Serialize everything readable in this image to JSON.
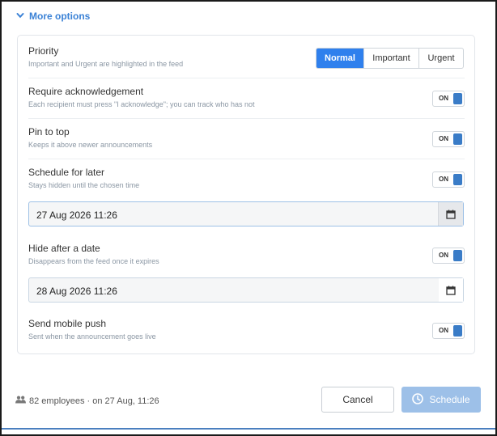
{
  "more_options": {
    "label": "More options",
    "icon": "chevron-down-icon",
    "color": "#3b82d6"
  },
  "priority": {
    "title": "Priority",
    "description": "Important and Urgent are highlighted in the feed",
    "options": [
      "Normal",
      "Important",
      "Urgent"
    ],
    "selected": "Normal"
  },
  "acknowledge": {
    "title": "Require acknowledgement",
    "description": "Each recipient must press \"I acknowledge\"; you can track who has not",
    "toggle": "ON"
  },
  "pin": {
    "title": "Pin to top",
    "description": "Keeps it above newer announcements",
    "toggle": "ON"
  },
  "schedule": {
    "title": "Schedule for later",
    "description": "Stays hidden until the chosen time",
    "toggle": "ON",
    "datetime": "27 Aug 2026 11:26"
  },
  "hide_after": {
    "title": "Hide after a date",
    "description": "Disappears from the feed once it expires",
    "toggle": "ON",
    "datetime": "28 Aug 2026 11:26"
  },
  "push": {
    "title": "Send mobile push",
    "description": "Sent when the announcement goes live",
    "toggle": "ON"
  },
  "footer": {
    "audience_icon": "users-icon",
    "audience_text": "82 employees · on 27 Aug, 11:26",
    "cancel_label": "Cancel",
    "schedule_label": "Schedule",
    "schedule_icon": "clock-icon"
  },
  "colors": {
    "accent": "#2f80ed",
    "toggle_knob": "#3a7cc7",
    "schedule_button": "#9dc0e8"
  }
}
